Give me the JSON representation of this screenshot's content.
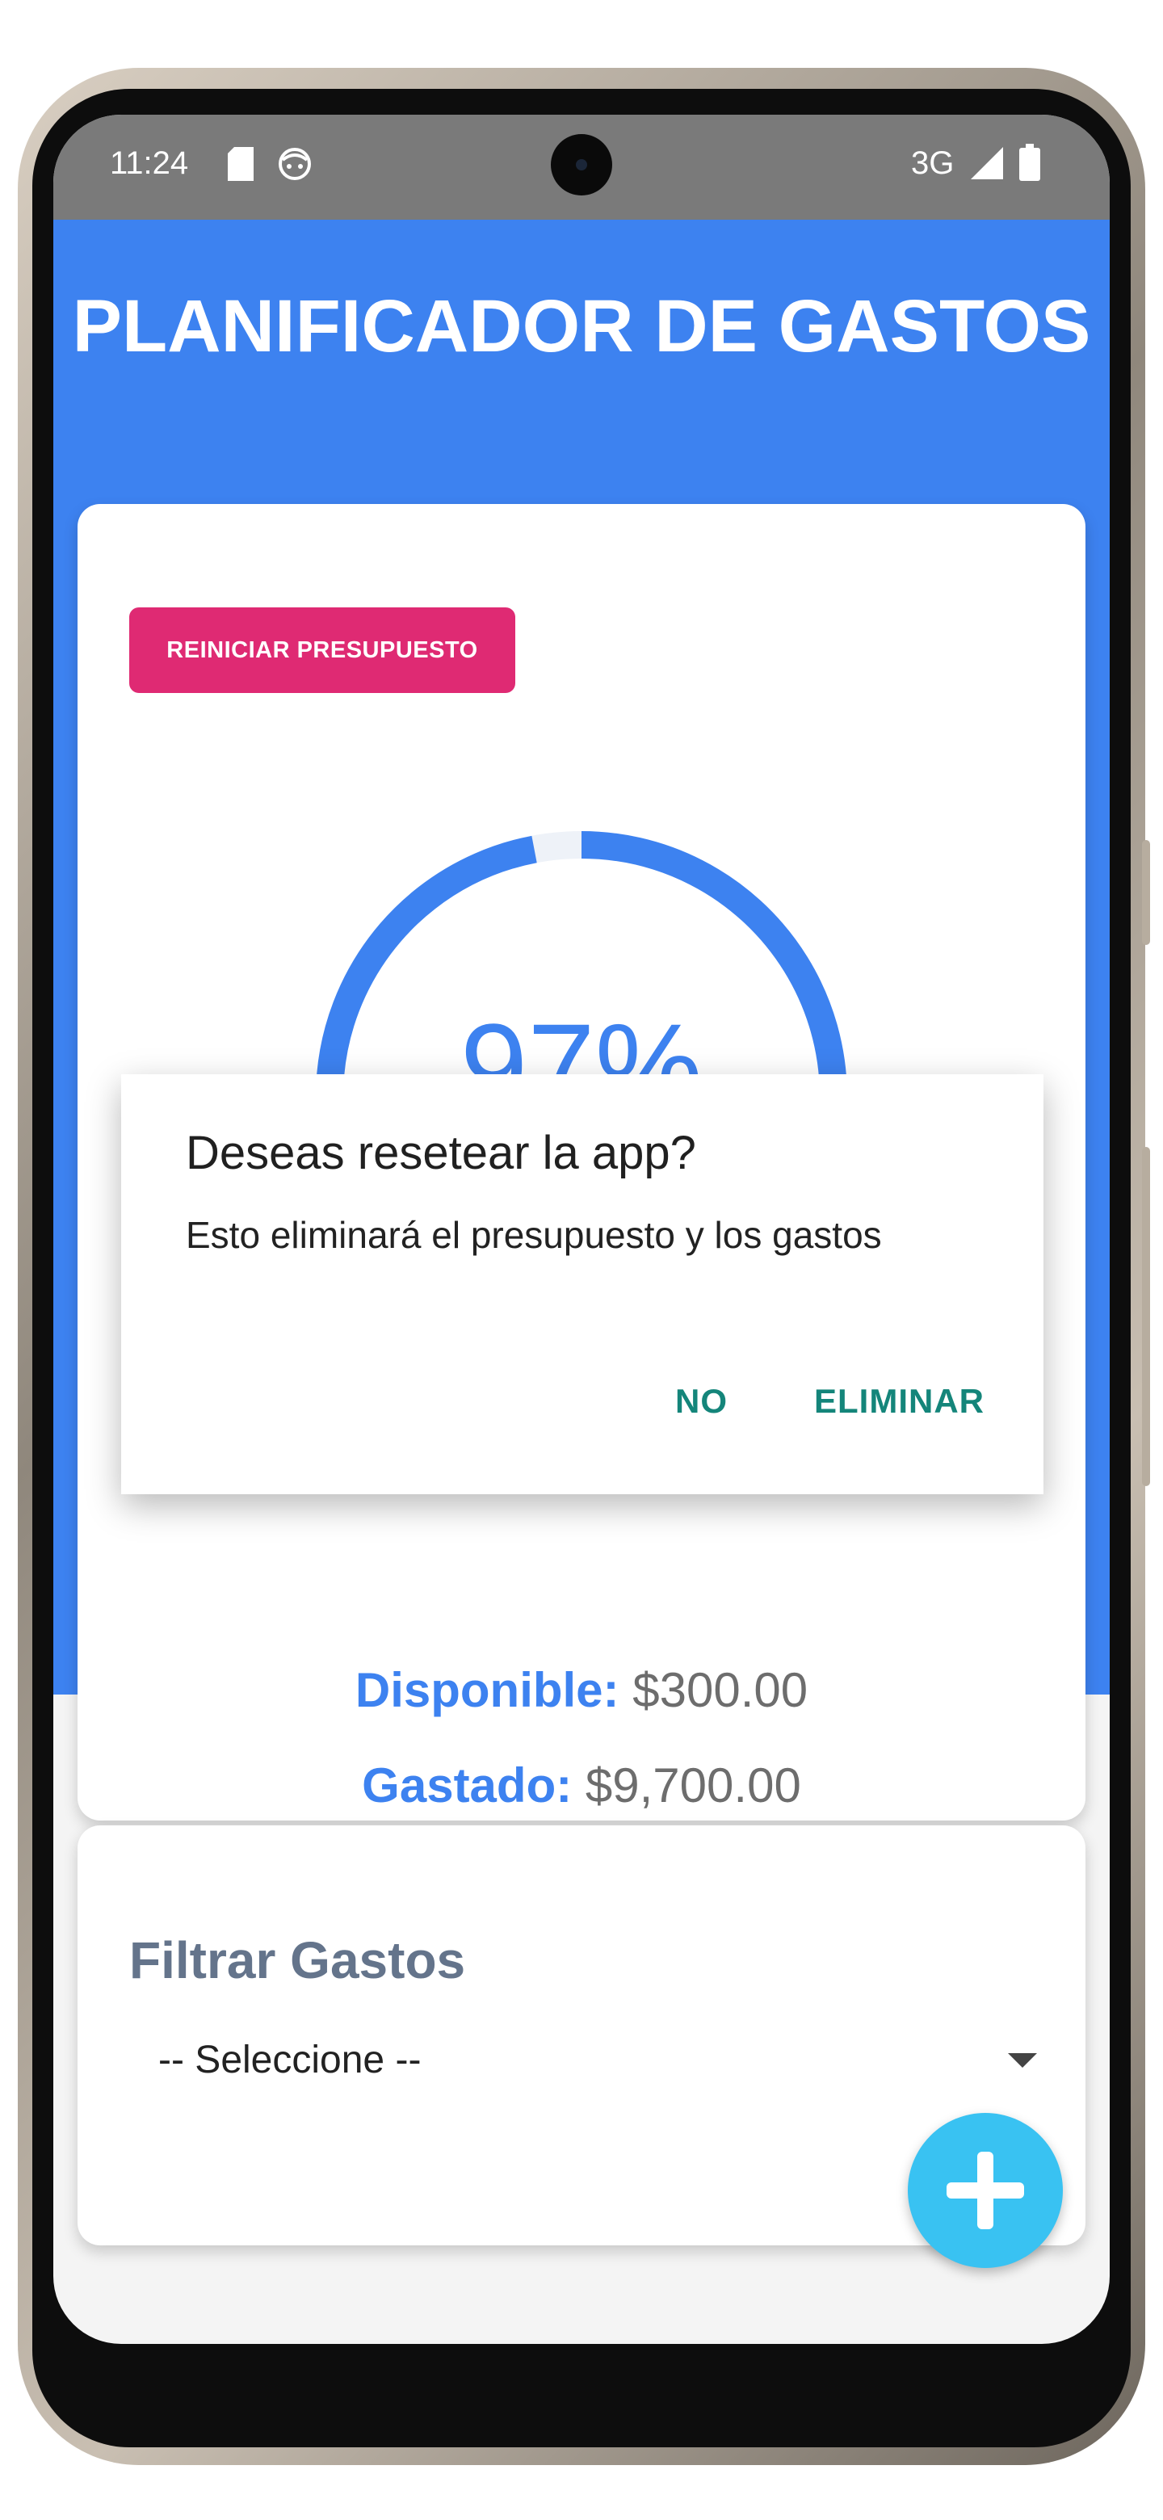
{
  "status_bar": {
    "time": "11:24",
    "network": "3G",
    "icons": [
      "sd-card-icon",
      "android-face-icon",
      "signal-icon",
      "battery-icon"
    ]
  },
  "app": {
    "title": "PLANIFICADOR DE GASTOS",
    "primary_color": "#3d82f0",
    "accent_color": "#df2a73"
  },
  "budget_card": {
    "reset_button_label": "REINICIAR PRESUPUESTO",
    "progress_text": "97%",
    "progress_value": 97,
    "available_label": "Disponible:",
    "available_value": "$300.00",
    "spent_label": "Gastado:",
    "spent_value": "$9,700.00"
  },
  "filter_card": {
    "title": "Filtrar Gastos",
    "select_value": "-- Seleccione --"
  },
  "dialog": {
    "title": "Deseas resetear la app?",
    "message": "Esto eliminará el presupuesto y los gastos",
    "cancel_label": "NO",
    "confirm_label": "ELIMINAR"
  },
  "fab": {
    "icon": "plus-icon",
    "color": "#39c2f2"
  }
}
